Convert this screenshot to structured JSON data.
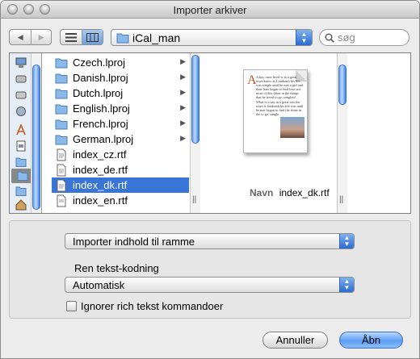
{
  "window": {
    "title": "Importer arkiver"
  },
  "toolbar": {
    "back_label": "◀",
    "forward_label": "▶",
    "path_folder": "iCal_man",
    "search_placeholder": "søg"
  },
  "sidebar": {
    "icons": [
      "computer-icon",
      "disk-icon",
      "disk-icon",
      "network-icon",
      "applications-icon",
      "documents-icon",
      "folder-icon",
      "folder-icon",
      "folder-icon",
      "home-icon"
    ]
  },
  "file_list": {
    "items": [
      {
        "name": "Czech.lproj",
        "kind": "folder",
        "selected": false
      },
      {
        "name": "Danish.lproj",
        "kind": "folder",
        "selected": false
      },
      {
        "name": "Dutch.lproj",
        "kind": "folder",
        "selected": false
      },
      {
        "name": "English.lproj",
        "kind": "folder",
        "selected": false
      },
      {
        "name": "French.lproj",
        "kind": "folder",
        "selected": false
      },
      {
        "name": "German.lproj",
        "kind": "folder",
        "selected": false
      },
      {
        "name": "index_cz.rtf",
        "kind": "rtf",
        "selected": false
      },
      {
        "name": "index_de.rtf",
        "kind": "rtf",
        "selected": false
      },
      {
        "name": "index_dk.rtf",
        "kind": "rtf",
        "selected": true
      },
      {
        "name": "index_en.rtf",
        "kind": "rtf",
        "selected": false
      }
    ]
  },
  "preview": {
    "doc_text": "A boy once lived w in a great town know as Londonth his life was simple until he met a girl and then later began to find love not most of this shine in the things that he loved to go. sanglotd . What is it say in a great tow the town is londonth his life was until he met began to find the shine in the to go. sanglo",
    "name_label": "Navn",
    "name_value": "index_dk.rtf"
  },
  "options": {
    "import_popup": "Importer indhold til ramme",
    "encoding_label": "Ren tekst-kodning",
    "encoding_popup": "Automatisk",
    "ignore_rich_text_label": "Ignorer rich tekst kommandoer",
    "ignore_rich_text_checked": false
  },
  "buttons": {
    "cancel_label": "Annuller",
    "open_label": "Åbn"
  },
  "colors": {
    "selection": "#3875d7",
    "default_button": "#5c9cf2"
  }
}
